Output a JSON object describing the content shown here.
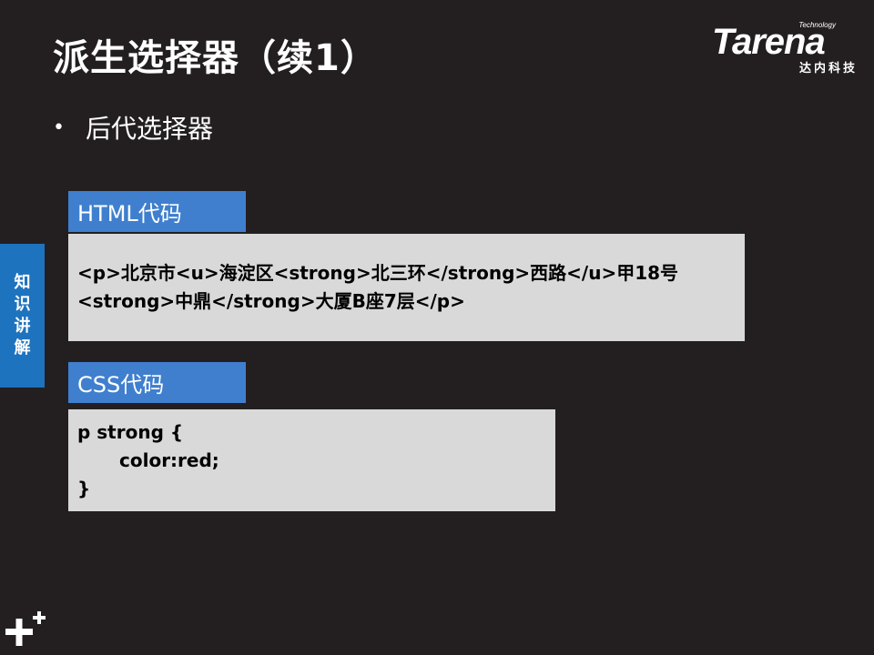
{
  "slide": {
    "title": "派生选择器（续1）",
    "bullet_text": "后代选择器"
  },
  "logo": {
    "tagline": "Technology",
    "wordmark": "Tarena",
    "chinese_name": "达内科技"
  },
  "side_tab": {
    "chars": [
      "知",
      "识",
      "讲",
      "解"
    ]
  },
  "html_section": {
    "label": "HTML代码",
    "lines": [
      "<p>北京市<u>海淀区<strong>北三环</strong>西路</u>甲18号",
      "<strong>中鼎</strong>大厦B座7层</p>"
    ]
  },
  "css_section": {
    "label": "CSS代码",
    "lines": [
      "p strong {",
      "color:red;",
      "}"
    ]
  },
  "colors": {
    "background": "#231f20",
    "label_blue": "#3f7fce",
    "tab_blue": "#1e73be",
    "code_bg": "#d9d9d9"
  }
}
